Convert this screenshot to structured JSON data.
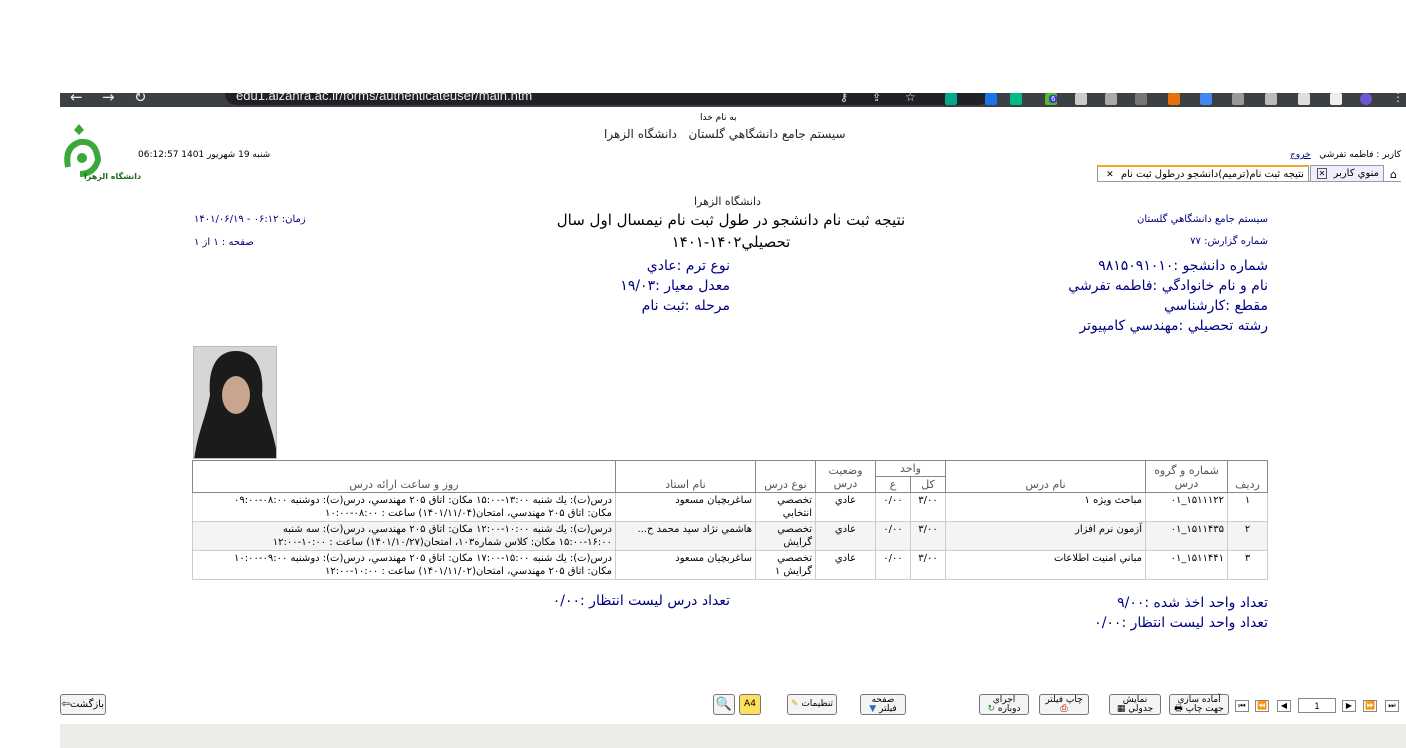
{
  "browser": {
    "url": "edu1.alzahra.ac.ir/forms/authenticateuser/main.htm",
    "tab_count_badge": "6"
  },
  "header": {
    "bismillah": "به نام خدا",
    "system_title": "سيستم جامع دانشگاهي گلستان",
    "university": "دانشگاه الزهرا",
    "logo_text": "دانشگاه الزهرا",
    "datetime": "06:12:57 شنبه 19 شهريور 1401",
    "user_label": "كاربر : فاطمه تفرشي",
    "logout": "خروج"
  },
  "tabs": [
    {
      "label": "منوي كاربر"
    },
    {
      "label": "نتيجه ثبت نام(ترميم)دانشجو درطول ثبت نام"
    }
  ],
  "report": {
    "university": "دانشگاه الزهرا",
    "title_line1": "نتيجه ثبت نام دانشجو در طول ثبت نام نيمسال اول سال",
    "title_line2": "تحصيلي۱۴۰۲-۱۴۰۱",
    "system": "سيستم جامع دانشگاهي گلستان",
    "report_no": "شماره گزارش: ۷۷",
    "time": "زمان: ۰۶:۱۲ - ۱۴۰۱/۰۶/۱۹",
    "page": "صفحه : ۱ از ۱",
    "student_no": "شماره دانشجو :۹۸۱۵۰۹۱۰۱۰",
    "full_name": "نام و نام خانوادگي :فاطمه تفرشي",
    "level": "مقطع :كارشناسي",
    "major": "رشته تحصيلي :مهندسي كامپيوتر",
    "term_type": "نوع ترم :عادي",
    "gpa": "معدل معيار :۱۹/۰۳",
    "stage": "مرحله :ثبت نام"
  },
  "table": {
    "headers": {
      "row": "رديف",
      "course_id": "شماره و گروه درس",
      "course_name": "نام درس",
      "units": "واحد",
      "units_total": "كل",
      "units_practical": "ع",
      "status": "وضعيت درس",
      "type": "نوع درس",
      "teacher": "نام استاد",
      "schedule": "روز و ساعت ارائه درس"
    },
    "rows": [
      {
        "row": "۱",
        "course_id": "۱۵۱۱۱۲۲_۰۱",
        "course_name": "مباحث ويژه ۱",
        "total": "۳/۰۰",
        "practical": "۰/۰۰",
        "status": "عادي",
        "type": "تخصصي انتخابي",
        "teacher": "ساغربچيان مسعود",
        "schedule_1": "درس(ت): يك شنبه ۱۳:۰۰-۱۵:۰۰ مكان: اتاق ۲۰۵ مهندسي، درس(ت): دوشنبه ۰۸:۰۰-۰۹:۰۰",
        "schedule_2": "مكان: اتاق ۲۰۵ مهندسي، امتحان(۱۴۰۱/۱۱/۰۴) ساعت : ۰۸:۰۰-۱۰:۰۰"
      },
      {
        "row": "۲",
        "course_id": "۱۵۱۱۴۳۵_۰۱",
        "course_name": "آزمون نرم افزار",
        "total": "۳/۰۰",
        "practical": "۰/۰۰",
        "status": "عادي",
        "type": "تخصصي گرايش",
        "teacher": "هاشمي نژاد سيد محمد ح...",
        "schedule_1": "درس(ت): يك شنبه ۱۰:۰۰-۱۲:۰۰ مكان: اتاق ۲۰۵ مهندسي، درس(ت): سه شنبه",
        "schedule_2": "۱۵:۰۰-۱۶:۰۰ مكان: كلاس شماره۱۰۳، امتحان(۱۴۰۱/۱۰/۲۷) ساعت : ۱۰:۰۰-۱۲:۰۰"
      },
      {
        "row": "۳",
        "course_id": "۱۵۱۱۴۴۱_۰۱",
        "course_name": "مباني امنيت اطلاعات",
        "total": "۳/۰۰",
        "practical": "۰/۰۰",
        "status": "عادي",
        "type": "تخصصي گرايش ۱",
        "teacher": "ساغربچيان مسعود",
        "schedule_1": "درس(ت): يك شنبه ۱۵:۰۰-۱۷:۰۰ مكان: اتاق ۲۰۵ مهندسي، درس(ت): دوشنبه ۰۹:۰۰-۱۰:۰۰",
        "schedule_2": "مكان: اتاق ۲۰۵ مهندسي، امتحان(۱۴۰۱/۱۱/۰۲) ساعت : ۱۰:۰۰-۱۲:۰۰"
      }
    ]
  },
  "summary": {
    "units_taken": "تعداد واحد اخذ شده :۹/۰۰",
    "waitlist_units": "تعداد واحد ليست انتظار :۰/۰۰",
    "waitlist_courses": "تعداد درس ليست انتظار :۰/۰۰"
  },
  "toolbar": {
    "back": "بازگشت",
    "a4": "A4",
    "settings": "تنظيمات",
    "filter": "صفحه فيلتر",
    "rerun": "اجراي دوباره",
    "print_filter": "چاپ فيلتر",
    "table_view": "نمايش جدولي",
    "print_ready": "آماده سازي جهت چاپ",
    "page_value": "1"
  }
}
